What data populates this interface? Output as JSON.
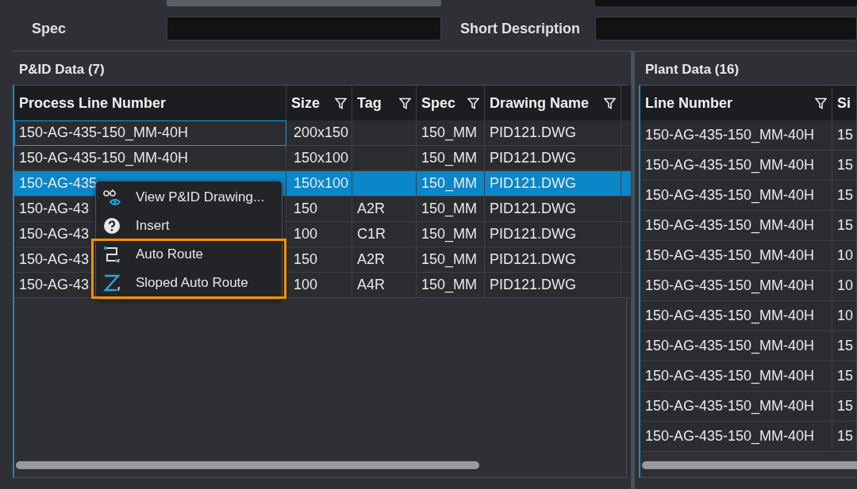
{
  "form": {
    "fields": [
      {
        "label": "Spec"
      },
      {
        "label": "Short Description"
      }
    ]
  },
  "pid_data": {
    "title": "P&ID Data (7)",
    "columns": [
      {
        "label": "Process Line Number",
        "filter": false
      },
      {
        "label": "Size",
        "filter": true
      },
      {
        "label": "Tag",
        "filter": true
      },
      {
        "label": "Spec",
        "filter": true
      },
      {
        "label": "Drawing Name",
        "filter": true
      }
    ],
    "rows": [
      {
        "cells": [
          "150-AG-435-150_MM-40H",
          "200x150",
          "",
          "150_MM",
          "PID121.DWG"
        ],
        "selected": false,
        "focused": true
      },
      {
        "cells": [
          "150-AG-435-150_MM-40H",
          "150x100",
          "",
          "150_MM",
          "PID121.DWG"
        ],
        "selected": false,
        "focused": false
      },
      {
        "cells": [
          "150-AG-435",
          "150x100",
          "",
          "150_MM",
          "PID121.DWG"
        ],
        "selected": true,
        "focused": false
      },
      {
        "cells": [
          "150-AG-43",
          "150",
          "A2R",
          "150_MM",
          "PID121.DWG"
        ],
        "selected": false,
        "focused": false
      },
      {
        "cells": [
          "150-AG-43",
          "100",
          "C1R",
          "150_MM",
          "PID121.DWG"
        ],
        "selected": false,
        "focused": false
      },
      {
        "cells": [
          "150-AG-43",
          "150",
          "A2R",
          "150_MM",
          "PID121.DWG"
        ],
        "selected": false,
        "focused": false
      },
      {
        "cells": [
          "150-AG-43",
          "100",
          "A4R",
          "150_MM",
          "PID121.DWG"
        ],
        "selected": false,
        "focused": false
      }
    ]
  },
  "context_menu": {
    "items": [
      {
        "label": "View P&ID Drawing...",
        "highlighted": false
      },
      {
        "label": "Insert",
        "highlighted": false
      },
      {
        "label": "Auto Route",
        "highlighted": true
      },
      {
        "label": "Sloped Auto Route",
        "highlighted": true
      }
    ]
  },
  "plant_data": {
    "title": "Plant Data (16)",
    "columns": [
      {
        "label": "Line Number",
        "filter": true
      },
      {
        "label": "Si"
      }
    ],
    "rows": [
      {
        "cells": [
          "150-AG-435-150_MM-40H",
          "15"
        ]
      },
      {
        "cells": [
          "150-AG-435-150_MM-40H",
          "15"
        ]
      },
      {
        "cells": [
          "150-AG-435-150_MM-40H",
          "15"
        ]
      },
      {
        "cells": [
          "150-AG-435-150_MM-40H",
          "15"
        ]
      },
      {
        "cells": [
          "150-AG-435-150_MM-40H",
          "10"
        ]
      },
      {
        "cells": [
          "150-AG-435-150_MM-40H",
          "10"
        ]
      },
      {
        "cells": [
          "150-AG-435-150_MM-40H",
          "10"
        ]
      },
      {
        "cells": [
          "150-AG-435-150_MM-40H",
          "15"
        ]
      },
      {
        "cells": [
          "150-AG-435-150_MM-40H",
          "15"
        ]
      },
      {
        "cells": [
          "150-AG-435-150_MM-40H",
          "15"
        ]
      },
      {
        "cells": [
          "150-AG-435-150_MM-40H",
          "15"
        ]
      }
    ]
  }
}
